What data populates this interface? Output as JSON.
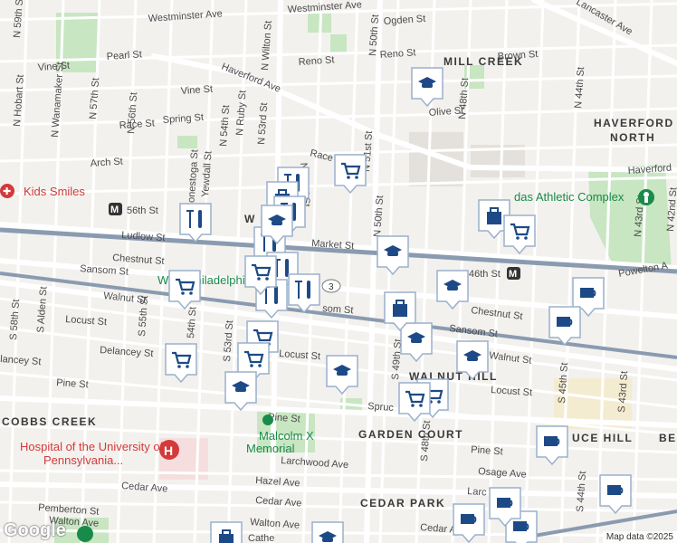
{
  "map": {
    "streets": {
      "westminster": "Westminster Ave",
      "ogden": "Ogden St",
      "n59": "N 59th St",
      "pearl": "Pearl St",
      "wilton": "N Wilton St",
      "n50_top": "N 50th St",
      "reno1": "Reno St",
      "reno2": "Reno St",
      "brown": "Brown St",
      "lancaster": "Lancaster Ave",
      "vine1": "Vine St",
      "vine2": "Vine St",
      "haverford_ave": "Haverford Ave",
      "hobart": "N Hobart St",
      "wanamaker": "N Wanamaker St",
      "n57": "N 57th St",
      "n56": "N 56th St",
      "n54": "N 54th St",
      "ruby": "N Ruby St",
      "n53": "N 53rd St",
      "n52": "N 52nd St",
      "spring": "Spring St",
      "race1": "Race St",
      "race2": "Race St",
      "arch": "Arch St",
      "conestoga": "Conestoga St",
      "yewdall": "Yewdall St",
      "olive": "Olive St",
      "aspen": "A",
      "n48": "N 48th St",
      "n44": "N 44th St",
      "n43": "N 43rd St",
      "n42": "N 42nd St",
      "n51": "N 51st St",
      "n50": "N 50th St",
      "haverford_edge": "Haverford",
      "ludlow": "Ludlow St",
      "market": "Market St",
      "chestnut1": "Chestnut St",
      "chestnut2": "Chestnut St",
      "sansom1": "Sansom St",
      "sansom2": "Sansom St",
      "sansom_mid": "som St",
      "s58": "S 58th St",
      "s57": "S 57th St",
      "alden": "S Alden St",
      "s55": "S 55th St",
      "s54": "54th St",
      "s53": "S 53rd St",
      "s49": "S 49th St",
      "s48": "S 48th St",
      "s45": "S 45th St",
      "s44": "S 44th St",
      "s43": "S 43rd St",
      "walnut1": "Walnut St",
      "walnut2": "Walnut St",
      "locust1": "Locust St",
      "locust2": "Locust St",
      "locust3": "Locust St",
      "lancey": "lancey St",
      "delancey": "Delancey St",
      "pine1": "Pine St",
      "pine2": "Pine St",
      "pine3": "Pine St",
      "spruce": "Spruc",
      "powelton": "Powelton A",
      "larchwood": "Larchwood Ave",
      "hazel": "Hazel Ave",
      "osage": "Osage Ave",
      "cedar1": "Cedar Ave",
      "cedar2": "Cedar Ave",
      "cedar3": "Cedar Ave",
      "pemberton": "Pemberton St",
      "walton1": "Walton Ave",
      "walton2": "Walton Ave",
      "larc": "Larc",
      "w56": "56th St",
      "cathe": "Cathe"
    },
    "neighborhoods": {
      "mill_creek": "MILL CREEK",
      "haverford_north_1": "HAVERFORD",
      "haverford_north_2": "NORTH",
      "cobbs_creek": "COBBS CREEK",
      "garden_court": "GARDEN COURT",
      "cedar_park": "CEDAR PARK",
      "walnut_hill": "WALNUT HILL",
      "spruce_hill": "UCE HILL",
      "be": "BE",
      "phila": "W  PHILA",
      "west_phila": "West Philadelphia"
    },
    "transit": {
      "station_56th": "56th St",
      "station_46th": "46th St"
    },
    "route_badge": "3",
    "places": {
      "kids_smiles": "Kids Smiles",
      "hospital_1": "Hospital of the University of",
      "hospital_2": "Pennsylvania...",
      "athletic": "das Athletic Complex",
      "malcolm_1": "Malcolm X",
      "malcolm_2": "Memorial"
    },
    "colors": {
      "road_major": "#ffffff",
      "el_track": "#8a9bb0",
      "park": "#c7e6c1",
      "marker": "#1d4a86",
      "hospital_red": "#d33a3a",
      "poi_green": "#1a8a4a"
    },
    "markers": [
      {
        "type": "school"
      },
      {
        "type": "cart"
      },
      {
        "type": "fork"
      },
      {
        "type": "bag"
      },
      {
        "type": "fork"
      },
      {
        "type": "fork"
      },
      {
        "type": "bag"
      },
      {
        "type": "fork"
      },
      {
        "type": "school"
      },
      {
        "type": "school"
      },
      {
        "type": "cart"
      },
      {
        "type": "school"
      },
      {
        "type": "cart"
      },
      {
        "type": "bag"
      },
      {
        "type": "fork"
      },
      {
        "type": "fork"
      },
      {
        "type": "fork"
      },
      {
        "type": "cart"
      },
      {
        "type": "cart"
      },
      {
        "type": "cart"
      },
      {
        "type": "school"
      },
      {
        "type": "school"
      },
      {
        "type": "school"
      },
      {
        "type": "school"
      },
      {
        "type": "cart"
      },
      {
        "type": "cart"
      },
      {
        "type": "cup"
      },
      {
        "type": "cup"
      },
      {
        "type": "cup"
      },
      {
        "type": "cup"
      },
      {
        "type": "cup"
      },
      {
        "type": "cup"
      },
      {
        "type": "cup"
      },
      {
        "type": "school"
      },
      {
        "type": "bag"
      },
      {
        "type": "cart"
      }
    ]
  },
  "footer": {
    "logo": "Google",
    "attribution": "Map data ©2025"
  }
}
